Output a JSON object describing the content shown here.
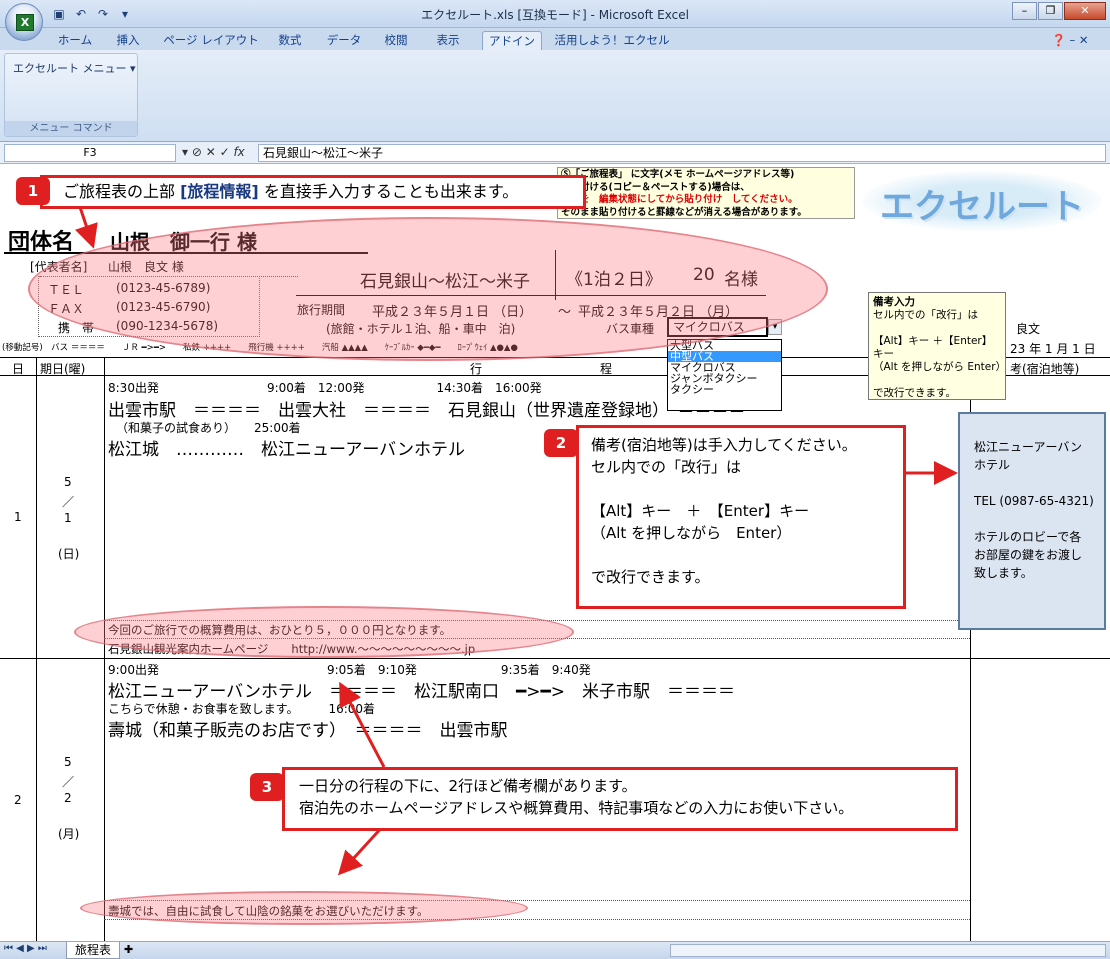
{
  "window": {
    "title": "エクセルート.xls [互換モード] - Microsoft Excel"
  },
  "tabs": [
    "ホーム",
    "挿入",
    "ページ レイアウト",
    "数式",
    "データ",
    "校閲",
    "表示",
    "アドイン",
    "活用しよう！エクセル"
  ],
  "ribbon": {
    "menu_button": "エクセルート メニュー",
    "group_caption": "メニュー コマンド"
  },
  "formula_bar": {
    "cell": "F3",
    "value": "石見銀山〜松江〜米子"
  },
  "sheet": {
    "logo_text": "エクセルート",
    "group_label": "団体名",
    "group_name": "山根　御一行 様",
    "rep_label": "[代表者名]",
    "rep_name": "山根　良文 様",
    "tel_label": "ＴＥＬ",
    "tel": "(0123-45-6789)",
    "fax_label": "ＦＡＸ",
    "fax": "(0123-45-6790)",
    "mobile_label": "携　帯",
    "mobile": "(090-1234-5678)",
    "route": "石見銀山〜松江〜米子",
    "nights": "《1泊２日》",
    "people": "20",
    "people_unit": "名様",
    "period_label": "旅行期間",
    "start_date": "平成２３年５月１日 （日）",
    "tilde": "〜",
    "end_date": "平成２３年５月２日 （月）",
    "accommodation": "(旅館・ホテル１泊、船・車中　泊)",
    "bus_label": "バス車種",
    "bus_value": "マイクロバス",
    "right_name": "良文",
    "right_date": "23 年 1 月 1 日",
    "legend": "(移動記号)　バス ＝＝＝＝　　ＪＲ ━>━>　　私鉄 ++++　　飛行機 ++++　　汽船 ▲▲▲▲　　ｹｰﾌﾞﾙｶｰ ◆━◆━　　ﾛｰﾌﾟｳｪｲ ▲●▲●",
    "top_note": {
      "line1": "Ⓢ「ご旅程表」 に文字(メモ ホームページアドレス等)",
      "line2": "貼り付ける(コピー＆ペーストする)場合は、",
      "line3": "セルを　編集状態にしてから貼り付け　してください。",
      "line4": "そのまま貼り付けると罫線などが消える場合があります。"
    },
    "header": {
      "day": "日",
      "date": "期日(曜)",
      "itinerary_left": "行",
      "itinerary_right": "程",
      "remarks": "考(宿泊地等)"
    },
    "bus_options": [
      "大型バス",
      "中型バス",
      "マイクロバス",
      "ジャンボタクシー",
      "タクシー"
    ],
    "tooltip": {
      "title": "備考入力",
      "lines": [
        "セル内での「改行」は",
        "",
        "【Alt】キー ＋【Enter】キー",
        "（Alt を押しながら Enter）",
        "",
        "で改行できます。"
      ]
    },
    "day1": {
      "num": "1",
      "month": "5",
      "sep": "／",
      "day": "1",
      "weekday": "(日)",
      "times1": "8:30出発　　　　　　　　　9:00着　12:00発　　　　　　14:30着　16:00発",
      "line1": "出雲市駅　＝＝＝＝　出雲大社　＝＝＝＝　石見銀山（世界遺産登録地）　＝＝＝＝",
      "note1": "（和菓子の試食あり）　　25:00着",
      "line2": "松江城　…………　松江ニューアーバンホテル",
      "memo1": "今回のご旅行での概算費用は、おひとり５，０００円となります。",
      "memo2": "石見銀山観光案内ホームページ　　http://www.〜〜〜〜〜〜〜〜〜.jp",
      "remarks": [
        "松江ニューアーバン",
        "ホテル",
        "",
        "TEL (0987-65-4321)",
        "",
        "ホテルのロビーで各",
        "お部屋の鍵をお渡し",
        "致します。"
      ]
    },
    "day2": {
      "num": "2",
      "month": "5",
      "sep": "／",
      "day": "2",
      "weekday": "(月)",
      "times1": "9:00出発　　　　　　　　　　　　　　9:05着　9:10発　　　　　　　9:35着　9:40発",
      "line1": "松江ニューアーバンホテル　＝＝＝＝　松江駅南口　━>━>　米子市駅　＝＝＝＝",
      "note1": "こちらで休憩・お食事を致します。　　　16:00着",
      "line2": "壽城（和菓子販売のお店です）　＝＝＝＝　出雲市駅",
      "memo1": "壽城では、自由に試食して山陰の銘菓をお選びいただけます。"
    }
  },
  "callouts": {
    "c1": {
      "num": "1",
      "pre": "ご旅程表の上部 ",
      "bold": "[旅程情報]",
      "post": " を直接手入力することも出来ます。"
    },
    "c2": {
      "num": "2",
      "lines": [
        "備考(宿泊地等)は手入力してください。",
        "セル内での「改行」は",
        "",
        "【Alt】キー　＋　【Enter】キー",
        "（Alt を押しながら　Enter）",
        "",
        "で改行できます。"
      ]
    },
    "c3": {
      "num": "3",
      "lines": [
        "一日分の行程の下に、2行ほど備考欄があります。",
        "宿泊先のホームページアドレスや概算費用、特記事項などの入力にお使い下さい。"
      ]
    }
  },
  "status": {
    "sheet_tab": "旅程表"
  },
  "colors": {
    "callout_red": "#e02020",
    "highlight_pink": "#ff7882",
    "ribbon_blue": "#c9d9ee"
  }
}
